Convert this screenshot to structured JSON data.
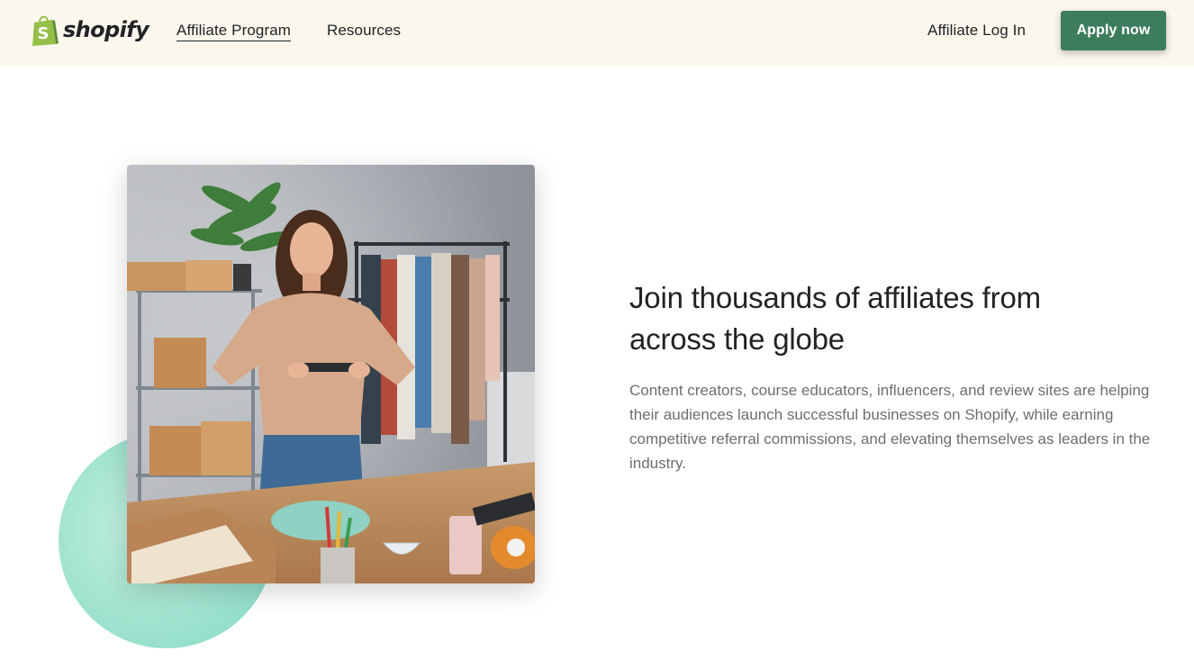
{
  "header": {
    "logo_text": "shopify",
    "logo_icon": "shopping-bag-icon",
    "nav": {
      "affiliate_program": "Affiliate Program",
      "resources": "Resources"
    },
    "login_label": "Affiliate Log In",
    "apply_label": "Apply now"
  },
  "hero": {
    "heading": "Join thousands of affiliates from across the globe",
    "body": "Content creators, course educators, influencers, and review sites are helping their audiences launch successful businesses on Shopify, while earning competitive referral commissions, and elevating themselves as leaders in the industry.",
    "image_subject": "woman-photographing-products"
  },
  "colors": {
    "header_bg": "#fbf7ed",
    "brand_green": "#3d7d5d",
    "logo_green": "#95bf47",
    "blob_mint": "#9fe3cf",
    "heading_text": "#212326",
    "body_text": "#6b6e73"
  }
}
